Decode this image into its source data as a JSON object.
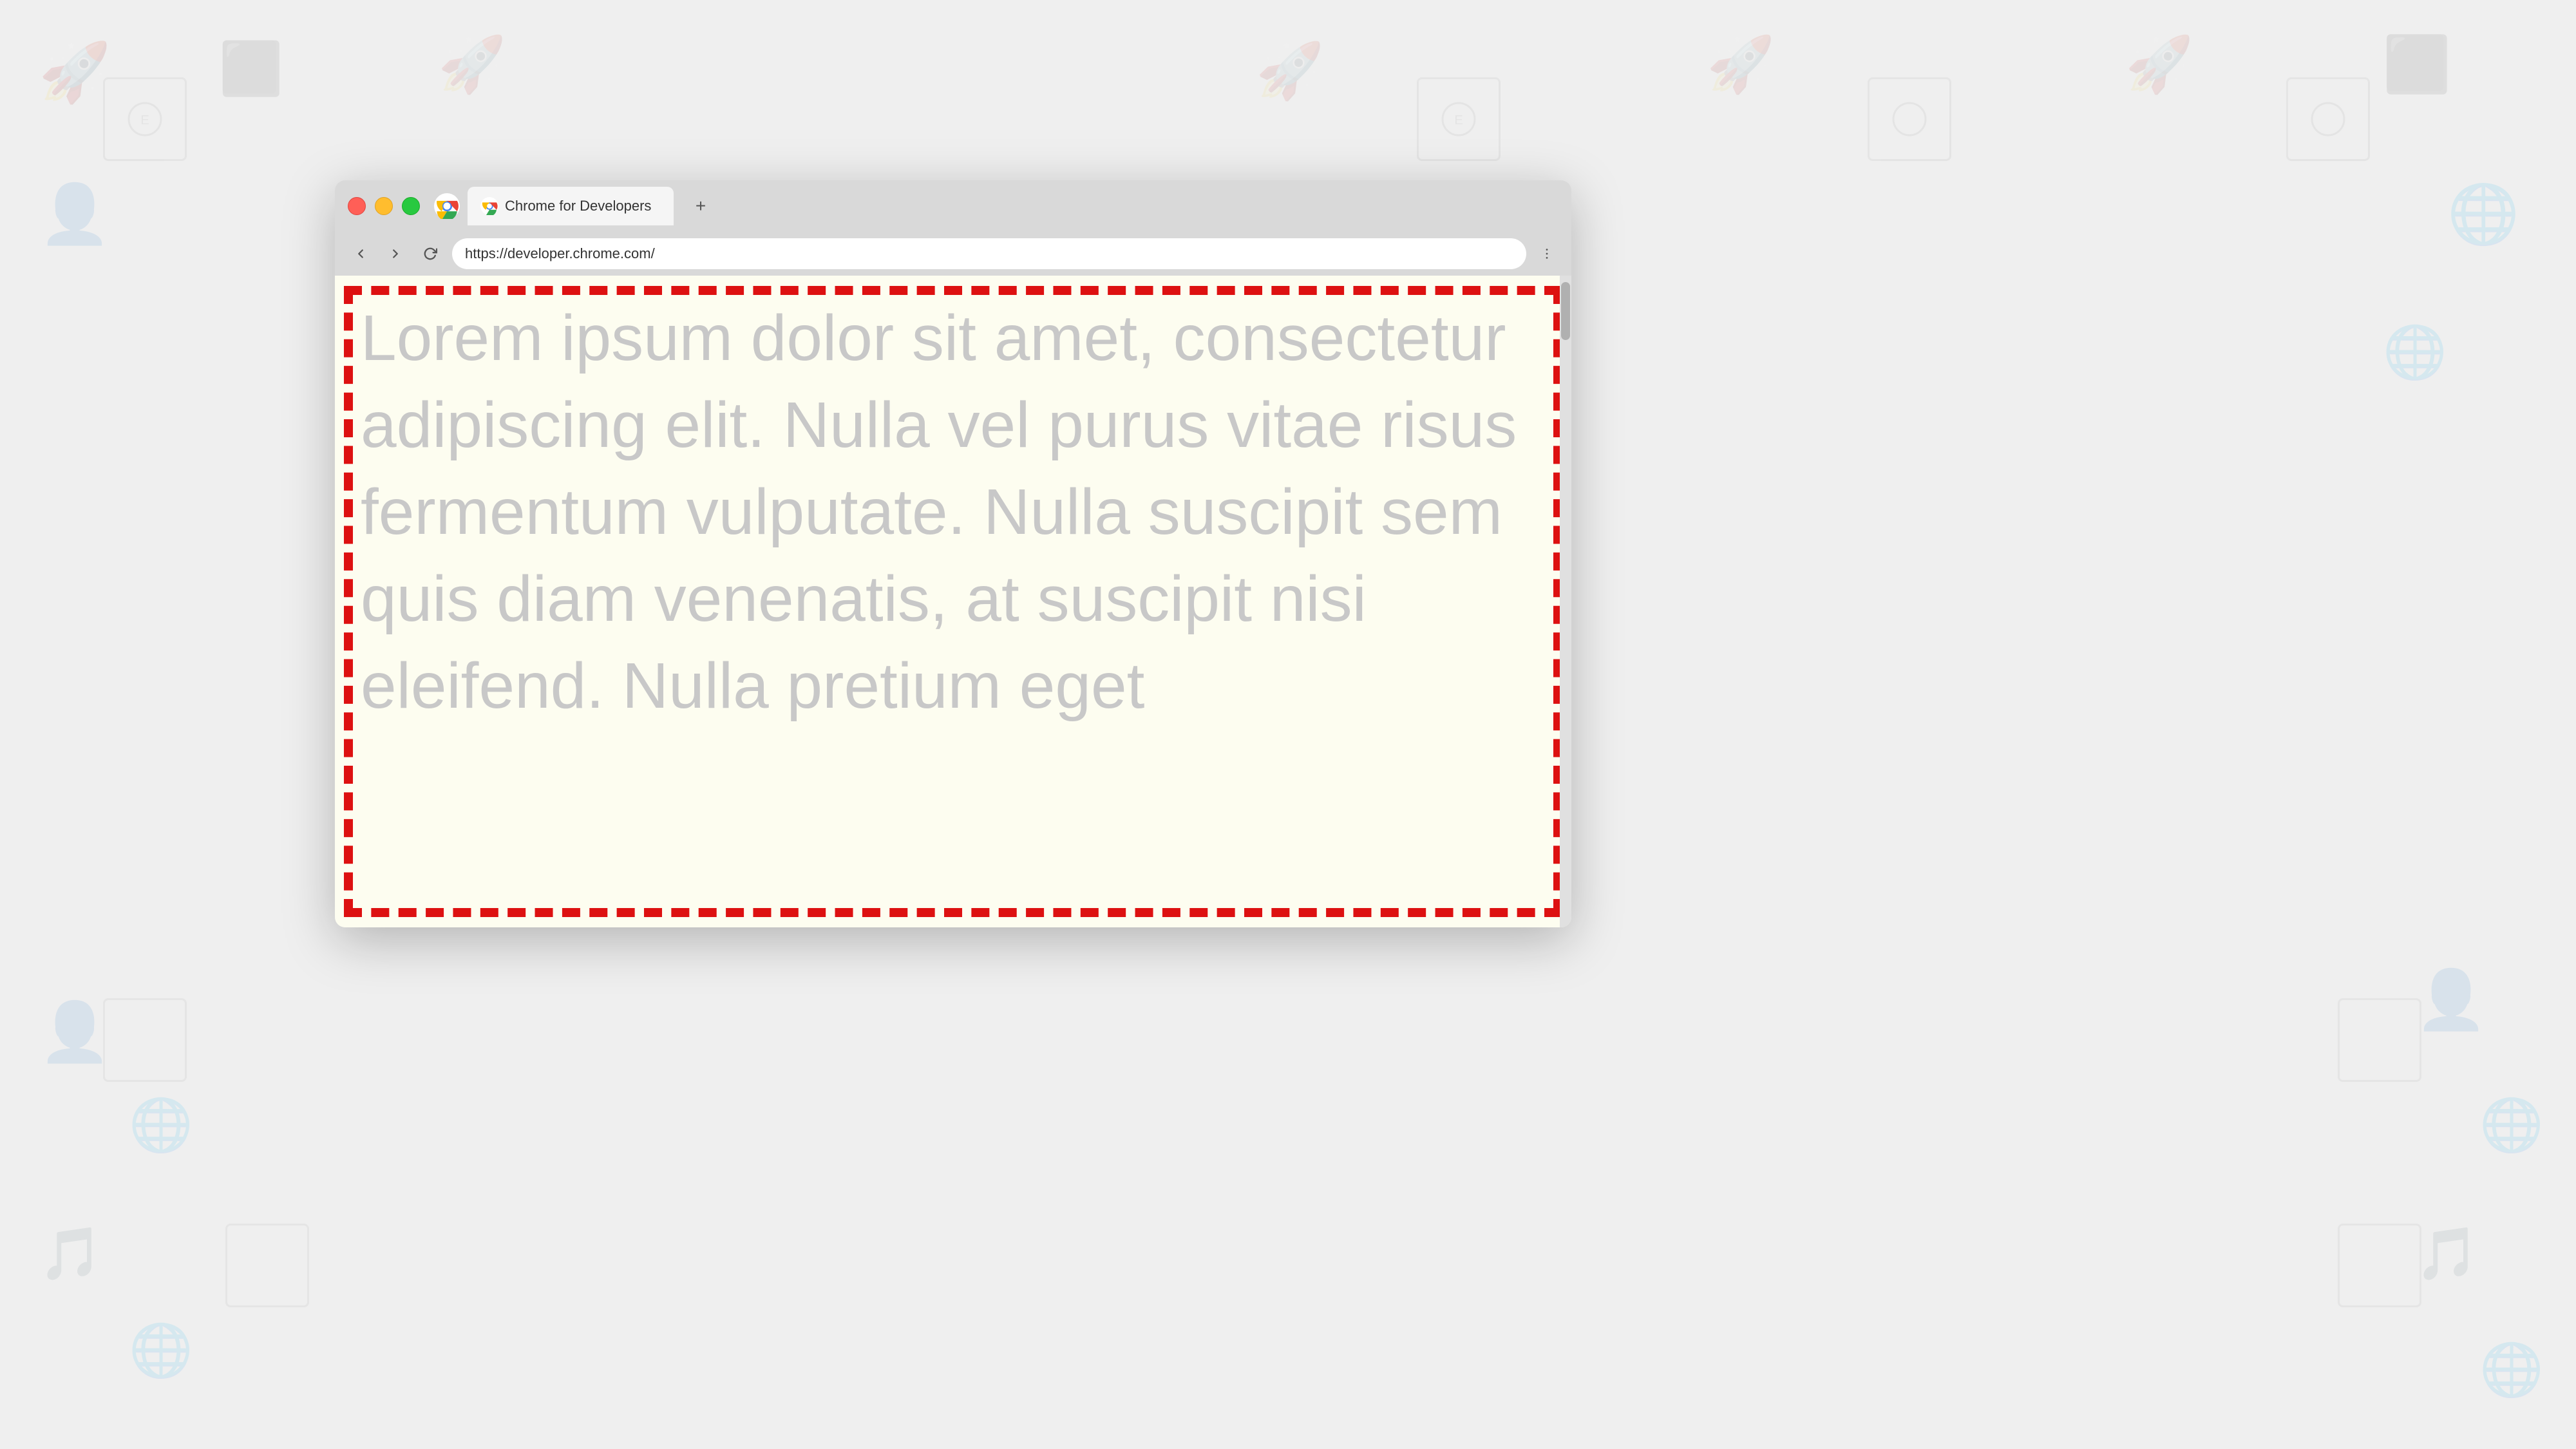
{
  "browser": {
    "tab": {
      "title": "Chrome for Developers",
      "new_tab_label": "+"
    },
    "address_bar": {
      "url": "https://developer.chrome.com/"
    },
    "nav": {
      "back_label": "←",
      "forward_label": "→",
      "refresh_label": "↺"
    },
    "menu_label": "⋮"
  },
  "page": {
    "lorem_text": "Lorem ipsum dolor sit amet, consectetur adipiscing elit. Nulla vel purus vitae risus fermentum vulputate. Nulla suscipit sem quis diam venenatis, at suscipit nisi eleifend. Nulla pretium eget"
  },
  "colors": {
    "close": "#ff5f57",
    "minimize": "#ffbd2e",
    "maximize": "#28c940",
    "dashed_border": "#dd1111",
    "page_bg": "#fdfdf0",
    "text_color": "#c8c8c8"
  }
}
